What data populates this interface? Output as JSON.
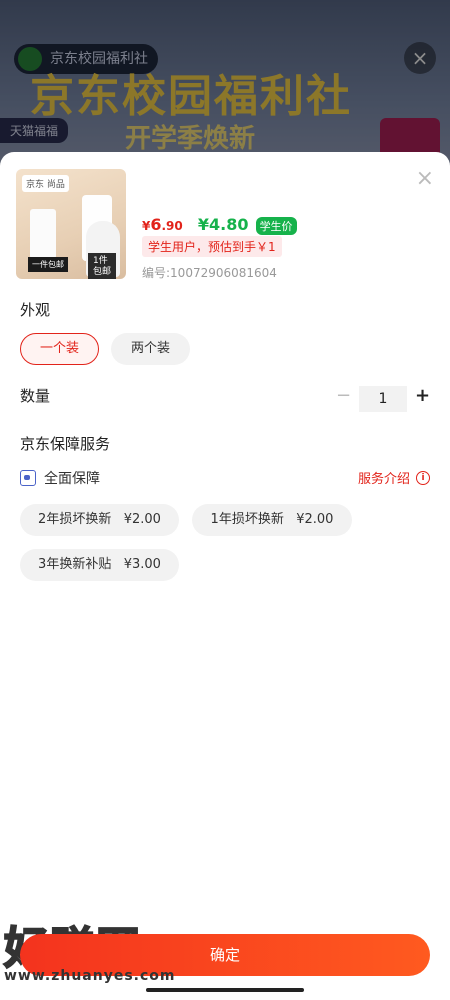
{
  "background": {
    "store_name": "京东校园福利社",
    "banner_title": "京东校园福利社",
    "banner_sub": "开学季焕新",
    "tag": "天猫福福"
  },
  "product": {
    "image_brand": "京东 尚品",
    "image_gift": "一件包邮",
    "image_promo": "1件\n包邮",
    "price": "6",
    "price_decimal": ".90",
    "currency": "¥",
    "student_price": "¥4.80",
    "student_tag": "学生价",
    "estimate_text": "学生用户，预估到手￥1",
    "sku_text": "编号:10072906081604"
  },
  "spec": {
    "title": "外观",
    "options": [
      {
        "label": "一个装",
        "selected": true
      },
      {
        "label": "两个装",
        "selected": false
      }
    ]
  },
  "quantity": {
    "title": "数量",
    "value": "1",
    "minus": "−",
    "plus": "+"
  },
  "service": {
    "title": "京东保障服务",
    "protect_label": "全面保障",
    "intro_label": "服务介绍",
    "info_glyph": "i",
    "options": [
      {
        "label": "2年损坏换新",
        "price": "¥2.00"
      },
      {
        "label": "1年损坏换新",
        "price": "¥2.00"
      },
      {
        "label": "3年换新补贴",
        "price": "¥3.00"
      }
    ]
  },
  "actions": {
    "confirm": "确定",
    "close": "×"
  },
  "watermark": {
    "text": "好赚网",
    "url": "www.zhuanyes.com"
  },
  "colors": {
    "accent": "#e2231a",
    "student": "#16b24b"
  }
}
